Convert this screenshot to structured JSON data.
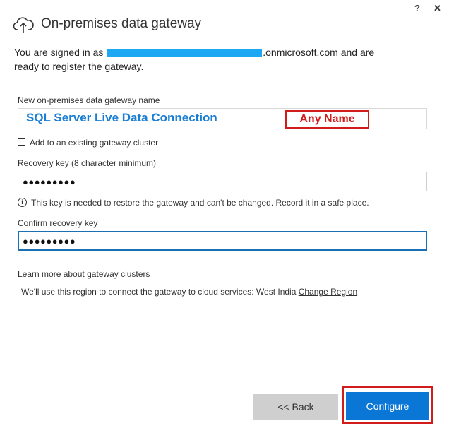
{
  "window": {
    "help_label": "?",
    "close_label": "✕",
    "title": "On-premises data gateway",
    "title_icon": "cloud-upload-icon"
  },
  "signin": {
    "prefix": "You are signed in as ",
    "suffix": ".onmicrosoft.com and are",
    "line2": "ready to register the gateway."
  },
  "form": {
    "gateway_name_label": "New on-premises data gateway name",
    "gateway_name_value": "SQL Server Live Data Connection",
    "callout": "Any Name",
    "cluster_checkbox_label": "Add to an existing gateway cluster",
    "recovery_key_label": "Recovery key (8 character minimum)",
    "recovery_key_mask": "●●●●●●●●●",
    "info_symbol": "i",
    "info_text": "This key is needed to restore the gateway and can't be changed. Record it in a safe place.",
    "confirm_key_label": "Confirm recovery key",
    "confirm_key_mask": "●●●●●●●●●"
  },
  "links": {
    "learn_more": "Learn more about gateway clusters",
    "region_text": "We'll use this region to connect the gateway to cloud services: West India ",
    "change_region": "Change Region"
  },
  "buttons": {
    "back": "<< Back",
    "configure": "Configure"
  },
  "colors": {
    "accent": "#0a77d6",
    "annotation_red": "#d21b1b",
    "value_blue": "#1a7fd4",
    "redaction": "#1ea7f3"
  }
}
